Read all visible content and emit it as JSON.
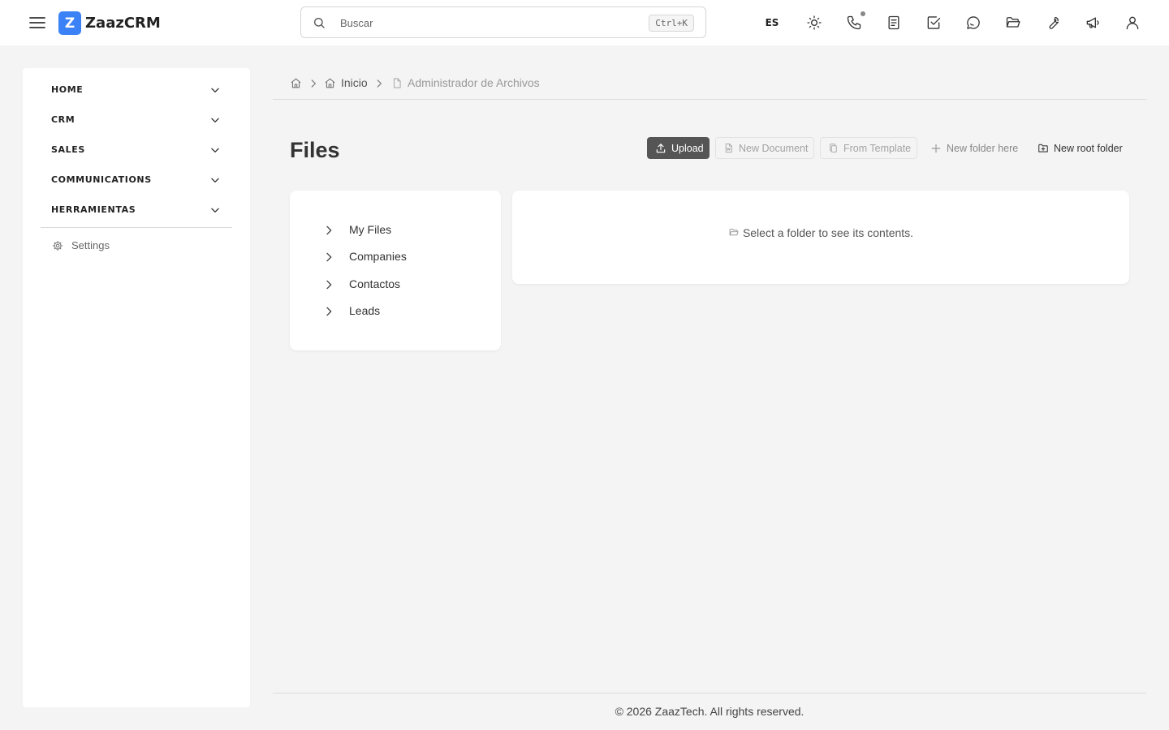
{
  "app": {
    "logo_letter": "Z",
    "name": "ZaazCRM",
    "brand_color": "#3b82f6"
  },
  "topbar": {
    "search": {
      "placeholder": "Buscar",
      "shortcut": "Ctrl+K"
    },
    "language": "ES",
    "icons": [
      "menu-icon",
      "sun-icon",
      "phone-icon",
      "document-icon",
      "checkbox-icon",
      "chat-icon",
      "folder-open-icon",
      "wrench-icon",
      "megaphone-icon",
      "user-icon"
    ]
  },
  "sidebar": {
    "groups": [
      {
        "label": "HOME"
      },
      {
        "label": "CRM"
      },
      {
        "label": "SALES"
      },
      {
        "label": "COMMUNICATIONS"
      },
      {
        "label": "HERRAMIENTAS"
      }
    ],
    "settings_label": "Settings"
  },
  "breadcrumb": {
    "items": [
      "Inicio",
      "Administrador de Archivos"
    ]
  },
  "page": {
    "title": "Files",
    "toolbar": {
      "upload": "Upload",
      "new_document": "New Document",
      "from_template": "From Template",
      "new_folder_here": "New folder here",
      "new_root_folder": "New root folder"
    },
    "folders": [
      "My Files",
      "Companies",
      "Contactos",
      "Leads"
    ],
    "empty_message": "Select a folder to see its contents."
  },
  "footer": {
    "text": "© 2026 ZaazTech. All rights reserved."
  }
}
